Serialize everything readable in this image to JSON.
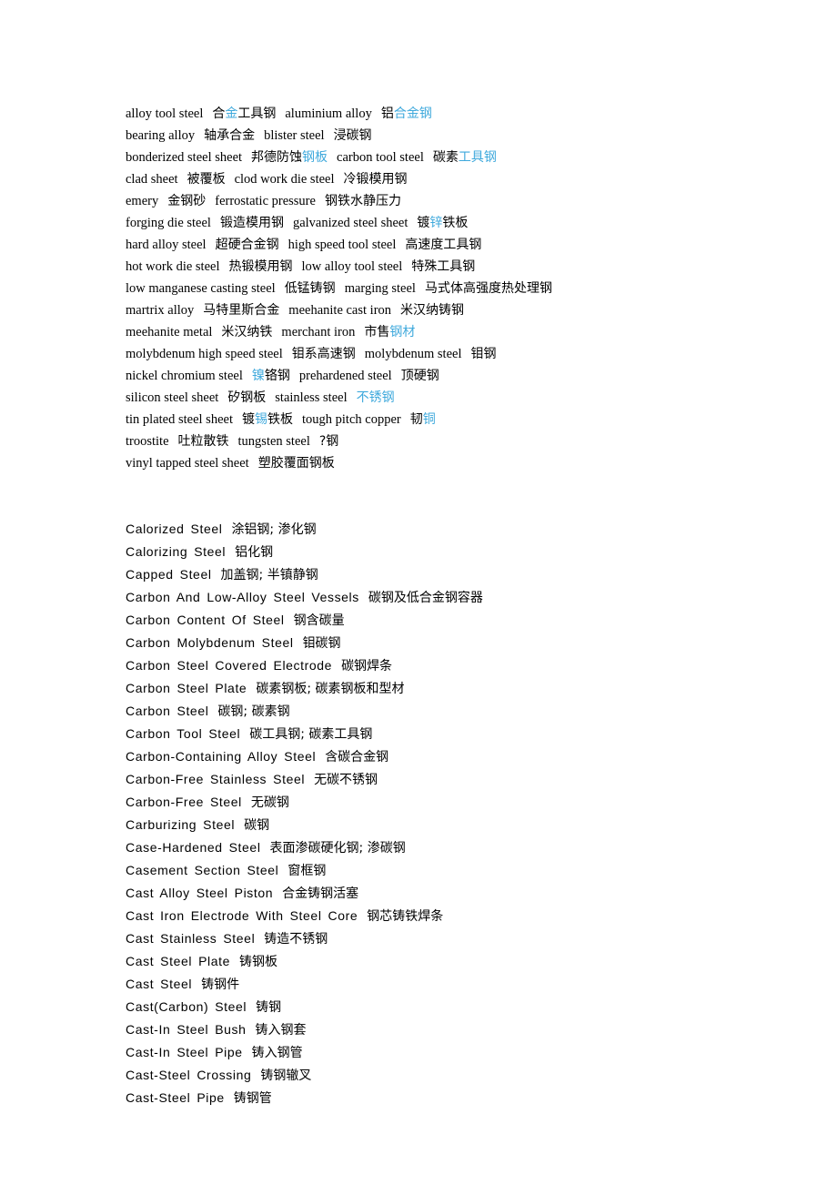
{
  "document": {
    "accent_color": "#3fa9dc",
    "text_color": "#000000",
    "background_color": "#ffffff"
  },
  "glossary_section": {
    "name": "steel-terms-serif-glossary",
    "lines": [
      [
        {
          "t": "alloy tool steel",
          "k": "en"
        },
        {
          "t": "合",
          "k": "cn"
        },
        {
          "t": "金",
          "k": "cn-hl"
        },
        {
          "t": "工具钢",
          "k": "cn"
        },
        {
          "t": "aluminium alloy",
          "k": "en"
        },
        {
          "t": "铝",
          "k": "cn"
        },
        {
          "t": "合金钢",
          "k": "cn-hl"
        }
      ],
      [
        {
          "t": "bearing alloy",
          "k": "en"
        },
        {
          "t": "轴承合金",
          "k": "cn"
        },
        {
          "t": "blister steel",
          "k": "en"
        },
        {
          "t": "浸碳钢",
          "k": "cn"
        }
      ],
      [
        {
          "t": "bonderized steel sheet",
          "k": "en"
        },
        {
          "t": "邦德防蚀",
          "k": "cn"
        },
        {
          "t": "钢板",
          "k": "cn-hl"
        },
        {
          "t": "carbon tool steel",
          "k": "en"
        },
        {
          "t": "碳素",
          "k": "cn"
        },
        {
          "t": "工具钢",
          "k": "cn-hl"
        }
      ],
      [
        {
          "t": "clad sheet",
          "k": "en"
        },
        {
          "t": "被覆板",
          "k": "cn"
        },
        {
          "t": "clod work die steel",
          "k": "en"
        },
        {
          "t": "冷锻模用钢",
          "k": "cn"
        }
      ],
      [
        {
          "t": "emery",
          "k": "en"
        },
        {
          "t": "金钢砂",
          "k": "cn"
        },
        {
          "t": "ferrostatic pressure",
          "k": "en"
        },
        {
          "t": "钢铁水静压力",
          "k": "cn"
        }
      ],
      [
        {
          "t": "forging die steel",
          "k": "en"
        },
        {
          "t": "锻造模用钢",
          "k": "cn"
        },
        {
          "t": "galvanized steel sheet",
          "k": "en"
        },
        {
          "t": "镀",
          "k": "cn"
        },
        {
          "t": "锌",
          "k": "cn-hl"
        },
        {
          "t": "铁板",
          "k": "cn"
        }
      ],
      [
        {
          "t": "hard alloy steel",
          "k": "en"
        },
        {
          "t": "超硬合金钢",
          "k": "cn"
        },
        {
          "t": "high speed tool steel",
          "k": "en"
        },
        {
          "t": "高速度工具钢",
          "k": "cn"
        }
      ],
      [
        {
          "t": "hot work die steel",
          "k": "en"
        },
        {
          "t": "热锻模用钢",
          "k": "cn"
        },
        {
          "t": "low alloy tool steel",
          "k": "en"
        },
        {
          "t": "特殊工具钢",
          "k": "cn"
        }
      ],
      [
        {
          "t": "low manganese casting steel",
          "k": "en"
        },
        {
          "t": "低锰铸钢",
          "k": "cn"
        },
        {
          "t": "marging steel",
          "k": "en"
        },
        {
          "t": "马式体高强度热处理钢",
          "k": "cn"
        }
      ],
      [
        {
          "t": "martrix alloy",
          "k": "en"
        },
        {
          "t": "马特里斯合金",
          "k": "cn"
        },
        {
          "t": "meehanite cast iron",
          "k": "en"
        },
        {
          "t": "米汉纳铸钢",
          "k": "cn"
        }
      ],
      [
        {
          "t": "meehanite metal",
          "k": "en"
        },
        {
          "t": "米汉纳铁",
          "k": "cn"
        },
        {
          "t": "merchant iron",
          "k": "en"
        },
        {
          "t": "市售",
          "k": "cn"
        },
        {
          "t": "钢材",
          "k": "cn-hl"
        }
      ],
      [
        {
          "t": "molybdenum high speed steel",
          "k": "en"
        },
        {
          "t": "钼系高速钢",
          "k": "cn"
        },
        {
          "t": "molybdenum steel",
          "k": "en"
        },
        {
          "t": "钼钢",
          "k": "cn"
        }
      ],
      [
        {
          "t": "nickel chromium steel",
          "k": "en"
        },
        {
          "t": "镍",
          "k": "cn-hl"
        },
        {
          "t": "铬钢",
          "k": "cn"
        },
        {
          "t": "prehardened steel",
          "k": "en"
        },
        {
          "t": "顶硬钢",
          "k": "cn"
        }
      ],
      [
        {
          "t": "silicon steel sheet",
          "k": "en"
        },
        {
          "t": "矽钢板",
          "k": "cn"
        },
        {
          "t": "stainless steel",
          "k": "en"
        },
        {
          "t": "不锈钢",
          "k": "cn-hl"
        }
      ],
      [
        {
          "t": "tin plated steel sheet",
          "k": "en"
        },
        {
          "t": "镀",
          "k": "cn"
        },
        {
          "t": "锡",
          "k": "cn-hl"
        },
        {
          "t": "铁板",
          "k": "cn"
        },
        {
          "t": "tough pitch copper",
          "k": "en"
        },
        {
          "t": "韧",
          "k": "cn"
        },
        {
          "t": "铜",
          "k": "cn-hl"
        }
      ],
      [
        {
          "t": "troostite",
          "k": "en"
        },
        {
          "t": "吐粒散铁",
          "k": "cn"
        },
        {
          "t": "tungsten steel",
          "k": "en"
        },
        {
          "t": "?钢",
          "k": "cn"
        }
      ],
      [
        {
          "t": "vinyl tapped steel sheet",
          "k": "en"
        },
        {
          "t": "塑胶覆面钢板",
          "k": "cn"
        }
      ]
    ]
  },
  "entries_section": {
    "name": "steel-terms-sans-entries",
    "lines": [
      {
        "en": "Calorized Steel",
        "cn": "涂铝钢; 渗化钢"
      },
      {
        "en": "Calorizing Steel",
        "cn": "铝化钢"
      },
      {
        "en": "Capped Steel",
        "cn": "加盖钢; 半镇静钢"
      },
      {
        "en": "Carbon And Low-Alloy Steel Vessels",
        "cn": "碳钢及低合金钢容器"
      },
      {
        "en": "Carbon Content Of Steel",
        "cn": "钢含碳量"
      },
      {
        "en": "Carbon Molybdenum Steel",
        "cn": "钼碳钢"
      },
      {
        "en": "Carbon Steel Covered Electrode",
        "cn": "碳钢焊条"
      },
      {
        "en": "Carbon Steel Plate",
        "cn": "碳素钢板; 碳素钢板和型材"
      },
      {
        "en": "Carbon Steel",
        "cn": "碳钢; 碳素钢"
      },
      {
        "en": "Carbon Tool Steel",
        "cn": "碳工具钢; 碳素工具钢"
      },
      {
        "en": "Carbon-Containing Alloy Steel",
        "cn": "含碳合金钢"
      },
      {
        "en": "Carbon-Free Stainless Steel",
        "cn": "无碳不锈钢"
      },
      {
        "en": "Carbon-Free Steel",
        "cn": "无碳钢"
      },
      {
        "en": "Carburizing Steel",
        "cn": "碳钢"
      },
      {
        "en": "Case-Hardened Steel",
        "cn": "表面渗碳硬化钢; 渗碳钢"
      },
      {
        "en": "Casement Section Steel",
        "cn": "窗框钢"
      },
      {
        "en": "Cast Alloy Steel Piston",
        "cn": "合金铸钢活塞"
      },
      {
        "en": "Cast Iron Electrode With Steel Core",
        "cn": "钢芯铸铁焊条"
      },
      {
        "en": "Cast Stainless Steel",
        "cn": "铸造不锈钢"
      },
      {
        "en": "Cast Steel Plate",
        "cn": "铸钢板"
      },
      {
        "en": "Cast Steel",
        "cn": "铸钢件"
      },
      {
        "en": "Cast(Carbon) Steel",
        "cn": "铸钢"
      },
      {
        "en": "Cast-In Steel Bush",
        "cn": "铸入钢套"
      },
      {
        "en": "Cast-In Steel Pipe",
        "cn": "铸入钢管"
      },
      {
        "en": "Cast-Steel Crossing",
        "cn": "铸钢辙叉"
      },
      {
        "en": "Cast-Steel Pipe",
        "cn": "铸钢管"
      }
    ]
  }
}
